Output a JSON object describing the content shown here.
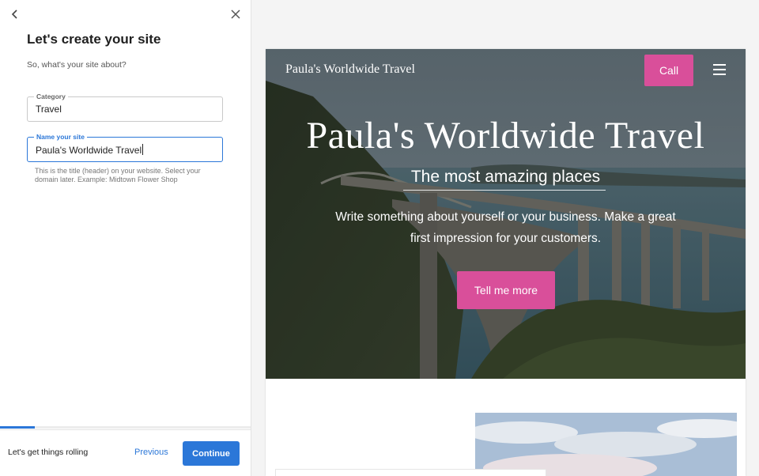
{
  "panel": {
    "title": "Let's create your site",
    "subtitle": "So, what's your site about?",
    "category": {
      "label": "Category",
      "value": "Travel"
    },
    "site_name": {
      "label": "Name your site",
      "value": "Paula's Worldwide Travel"
    },
    "helper_text": "This is the title (header) on your website. Select your domain later. Example: Midtown Flower Shop",
    "progress": 0.14,
    "footer": {
      "status_text": "Let's get things rolling",
      "previous_label": "Previous",
      "continue_label": "Continue"
    },
    "accent_color": "#2b77d8"
  },
  "preview": {
    "site_name": "Paula's Worldwide Travel",
    "call_label": "Call",
    "hero_title": "Paula's Worldwide Travel",
    "tagline": "The most amazing places",
    "description": "Write something about yourself or your business. Make a great first impression for your customers.",
    "cta_label": "Tell me more",
    "brand_color": "#d94f9a"
  },
  "icons": {
    "back": "chevron-left-icon",
    "close": "close-icon",
    "menu": "hamburger-menu-icon"
  }
}
